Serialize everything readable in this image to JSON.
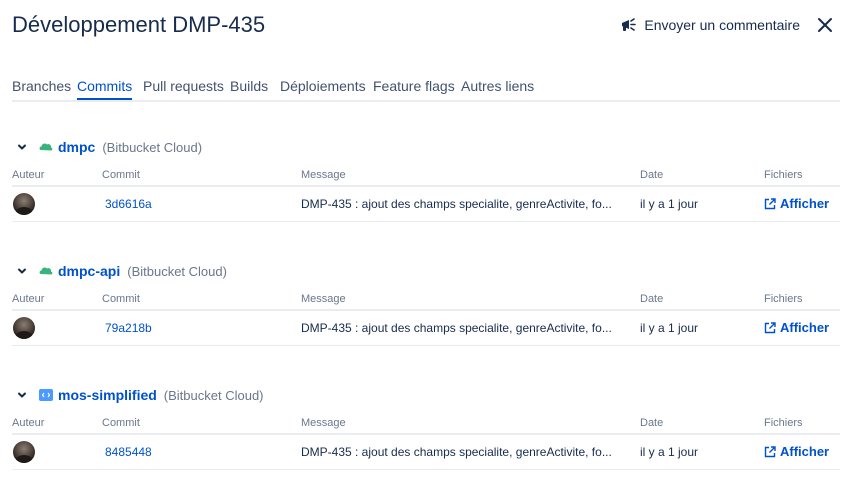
{
  "header": {
    "title": "Développement DMP-435",
    "feedback_label": "Envoyer un commentaire"
  },
  "tabs": [
    {
      "label": "Branches"
    },
    {
      "label": "Commits",
      "active": true
    },
    {
      "label": "Pull requests"
    },
    {
      "label": "Builds"
    },
    {
      "label": "Déploiements"
    },
    {
      "label": "Feature flags"
    },
    {
      "label": "Autres liens"
    }
  ],
  "columns": {
    "author": "Auteur",
    "commit": "Commit",
    "message": "Message",
    "date": "Date",
    "files": "Fichiers"
  },
  "repos": [
    {
      "name": "dmpc",
      "host": "(Bitbucket Cloud)",
      "icon": "bitbucket-repo-icon",
      "icon_color": "#36b37e",
      "commit": {
        "hash": "3d6616a",
        "message": "DMP-435 : ajout des champs specialite, genreActivite, fo...",
        "date": "il y a 1 jour",
        "view_label": "Afficher"
      }
    },
    {
      "name": "dmpc-api",
      "host": "(Bitbucket Cloud)",
      "icon": "bitbucket-repo-icon",
      "icon_color": "#36b37e",
      "commit": {
        "hash": "79a218b",
        "message": "DMP-435 : ajout des champs specialite, genreActivite, fo...",
        "date": "il y a 1 jour",
        "view_label": "Afficher"
      }
    },
    {
      "name": "mos-simplified",
      "host": "(Bitbucket Cloud)",
      "icon": "code-repo-icon",
      "icon_color": "#4c9aff",
      "commit": {
        "hash": "8485448",
        "message": "DMP-435 : ajout des champs specialite, genreActivite, fo...",
        "date": "il y a 1 jour",
        "view_label": "Afficher"
      }
    }
  ],
  "colors": {
    "link": "#0052cc",
    "text": "#172b4d",
    "subtle": "#6b778c",
    "divider": "#ebecf0"
  }
}
